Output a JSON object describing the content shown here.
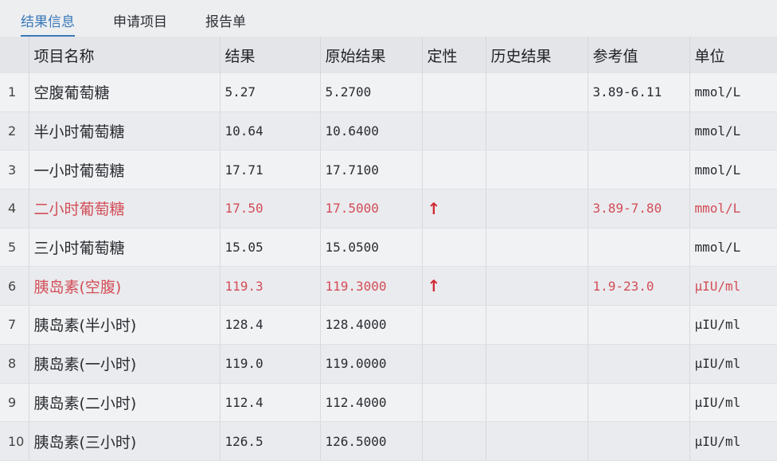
{
  "tabs": [
    {
      "label": "结果信息",
      "active": true
    },
    {
      "label": "申请项目",
      "active": false
    },
    {
      "label": "报告单",
      "active": false
    }
  ],
  "columns": [
    "项目名称",
    "结果",
    "原始结果",
    "定性",
    "历史结果",
    "参考值",
    "单位"
  ],
  "rows": [
    {
      "idx": "1",
      "name": "空腹葡萄糖",
      "result": "5.27",
      "raw": "5.2700",
      "qual": "",
      "history": "",
      "ref": "3.89-6.11",
      "unit": "mmol/L",
      "abnormal": false
    },
    {
      "idx": "2",
      "name": "半小时葡萄糖",
      "result": "10.64",
      "raw": "10.6400",
      "qual": "",
      "history": "",
      "ref": "",
      "unit": "mmol/L",
      "abnormal": false
    },
    {
      "idx": "3",
      "name": "一小时葡萄糖",
      "result": "17.71",
      "raw": "17.7100",
      "qual": "",
      "history": "",
      "ref": "",
      "unit": "mmol/L",
      "abnormal": false
    },
    {
      "idx": "4",
      "name": "二小时葡萄糖",
      "result": "17.50",
      "raw": "17.5000",
      "qual": "↑",
      "history": "",
      "ref": "3.89-7.80",
      "unit": "mmol/L",
      "abnormal": true
    },
    {
      "idx": "5",
      "name": "三小时葡萄糖",
      "result": "15.05",
      "raw": "15.0500",
      "qual": "",
      "history": "",
      "ref": "",
      "unit": "mmol/L",
      "abnormal": false
    },
    {
      "idx": "6",
      "name": "胰岛素(空腹)",
      "result": "119.3",
      "raw": "119.3000",
      "qual": "↑",
      "history": "",
      "ref": "1.9-23.0",
      "unit": "μIU/ml",
      "abnormal": true
    },
    {
      "idx": "7",
      "name": "胰岛素(半小时)",
      "result": "128.4",
      "raw": "128.4000",
      "qual": "",
      "history": "",
      "ref": "",
      "unit": "μIU/ml",
      "abnormal": false
    },
    {
      "idx": "8",
      "name": "胰岛素(一小时)",
      "result": "119.0",
      "raw": "119.0000",
      "qual": "",
      "history": "",
      "ref": "",
      "unit": "μIU/ml",
      "abnormal": false
    },
    {
      "idx": "9",
      "name": "胰岛素(二小时)",
      "result": "112.4",
      "raw": "112.4000",
      "qual": "",
      "history": "",
      "ref": "",
      "unit": "μIU/ml",
      "abnormal": false
    },
    {
      "idx": "10",
      "name": "胰岛素(三小时)",
      "result": "126.5",
      "raw": "126.5000",
      "qual": "",
      "history": "",
      "ref": "",
      "unit": "μIU/ml",
      "abnormal": false
    }
  ],
  "colors": {
    "accent": "#3a78b8",
    "abnormal": "#d24d57"
  }
}
